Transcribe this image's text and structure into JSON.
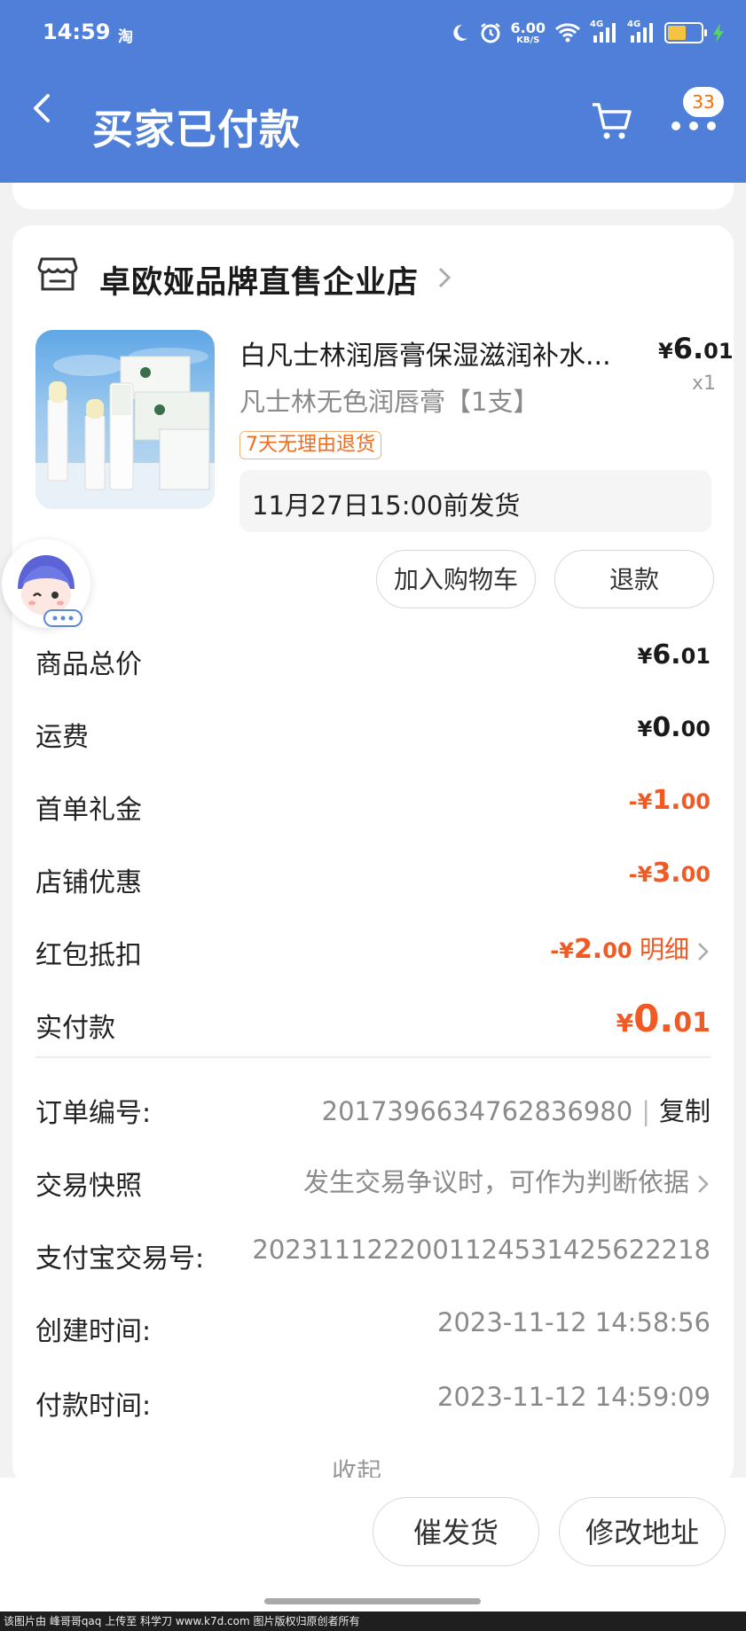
{
  "status_bar": {
    "time": "14:59",
    "app_glyph": "淘",
    "net_speed_value": "6.00",
    "net_speed_unit": "KB/S",
    "signal_1": "4G",
    "signal_2": "4G",
    "battery_level": 0.55,
    "icons": [
      "moon-icon",
      "alarm-icon",
      "wifi-icon",
      "signal-icon",
      "battery-icon",
      "charging-icon"
    ]
  },
  "header": {
    "title": "买家已付款",
    "cart_badge": "33"
  },
  "shop": {
    "name": "卓欧娅品牌直售企业店"
  },
  "product": {
    "title": "白凡士林润唇膏保湿滋润补水...",
    "price_symbol": "¥",
    "price_int": "6.",
    "price_dec": "01",
    "qty": "x1",
    "spec": "凡士林无色润唇膏【1支】",
    "tag": "7天无理由退货",
    "ship_note": "11月27日15:00前发货",
    "actions": {
      "add_cart": "加入购物车",
      "refund": "退款"
    }
  },
  "price_rows": [
    {
      "label": "商品总价",
      "prefix": "¥",
      "int": "6.",
      "dec": "01",
      "negative": false
    },
    {
      "label": "运费",
      "prefix": "¥",
      "int": "0.",
      "dec": "00",
      "negative": false
    },
    {
      "label": "首单礼金",
      "prefix": "-¥",
      "int": "1.",
      "dec": "00",
      "negative": true
    },
    {
      "label": "店铺优惠",
      "prefix": "-¥",
      "int": "3.",
      "dec": "00",
      "negative": true
    },
    {
      "label": "红包抵扣",
      "prefix": "-¥",
      "int": "2.",
      "dec": "00",
      "negative": true,
      "detail": "明细"
    }
  ],
  "paid": {
    "label": "实付款",
    "prefix": "¥",
    "int": "0.",
    "dec": "01"
  },
  "order_info": {
    "order_no_label": "订单编号:",
    "order_no": "2017396634762836980",
    "separator": "|",
    "copy": "复制",
    "snapshot_label": "交易快照",
    "snapshot_value": "发生交易争议时，可作为判断依据",
    "alipay_label": "支付宝交易号:",
    "alipay_no": "2023111222001124531425622218",
    "created_label": "创建时间:",
    "created_time": "2023-11-12 14:58:56",
    "paid_label": "付款时间:",
    "paid_time": "2023-11-12 14:59:09",
    "collapse": "收起"
  },
  "bottom_actions": {
    "urge": "催发货",
    "change_addr": "修改地址"
  },
  "watermark": "该图片由 峰哥哥qaq 上传至 科学刀 www.k7d.com 图片版权归原创者所有",
  "colors": {
    "header_bg": "#4f7fd8",
    "accent": "#f15a24",
    "page_bg": "#f2f2f2"
  }
}
